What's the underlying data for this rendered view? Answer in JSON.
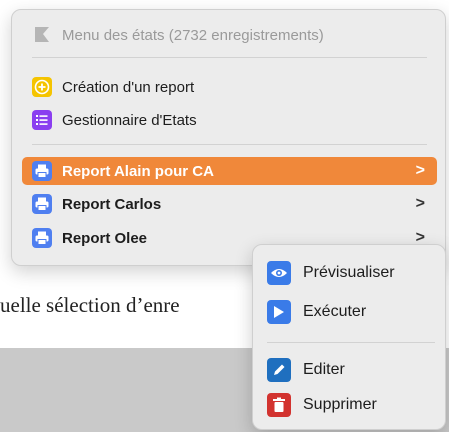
{
  "background": {
    "partial_text": "uelle sélection d’enre"
  },
  "menu": {
    "header": {
      "label": "Menu des états (2732 enregistrements)",
      "icon": "flag-icon"
    },
    "items": [
      {
        "label": "Création d'un report",
        "icon": "plus-circle-icon",
        "color": "#f5c400"
      },
      {
        "label": "Gestionnaire d'Etats",
        "icon": "list-icon",
        "color": "#8a3ef0"
      }
    ],
    "reports": [
      {
        "label": "Report Alain pour CA",
        "icon": "printer-icon",
        "selected": true
      },
      {
        "label": "Report Carlos",
        "icon": "printer-icon",
        "selected": false
      },
      {
        "label": "Report Olee",
        "icon": "printer-icon",
        "selected": false
      }
    ],
    "chevron": ">"
  },
  "submenu": {
    "items": [
      {
        "label": "Prévisualiser",
        "icon": "eye-icon",
        "color": "#3a7be8"
      },
      {
        "label": "Exécuter",
        "icon": "play-icon",
        "color": "#3a7be8"
      },
      {
        "label": "Editer",
        "icon": "pencil-icon",
        "color": "#1f6fbf"
      },
      {
        "label": "Supprimer",
        "icon": "trash-icon",
        "color": "#d2332f"
      }
    ]
  },
  "colors": {
    "selected_row": "#f0883a",
    "report_icon": "#4f7ff0"
  }
}
